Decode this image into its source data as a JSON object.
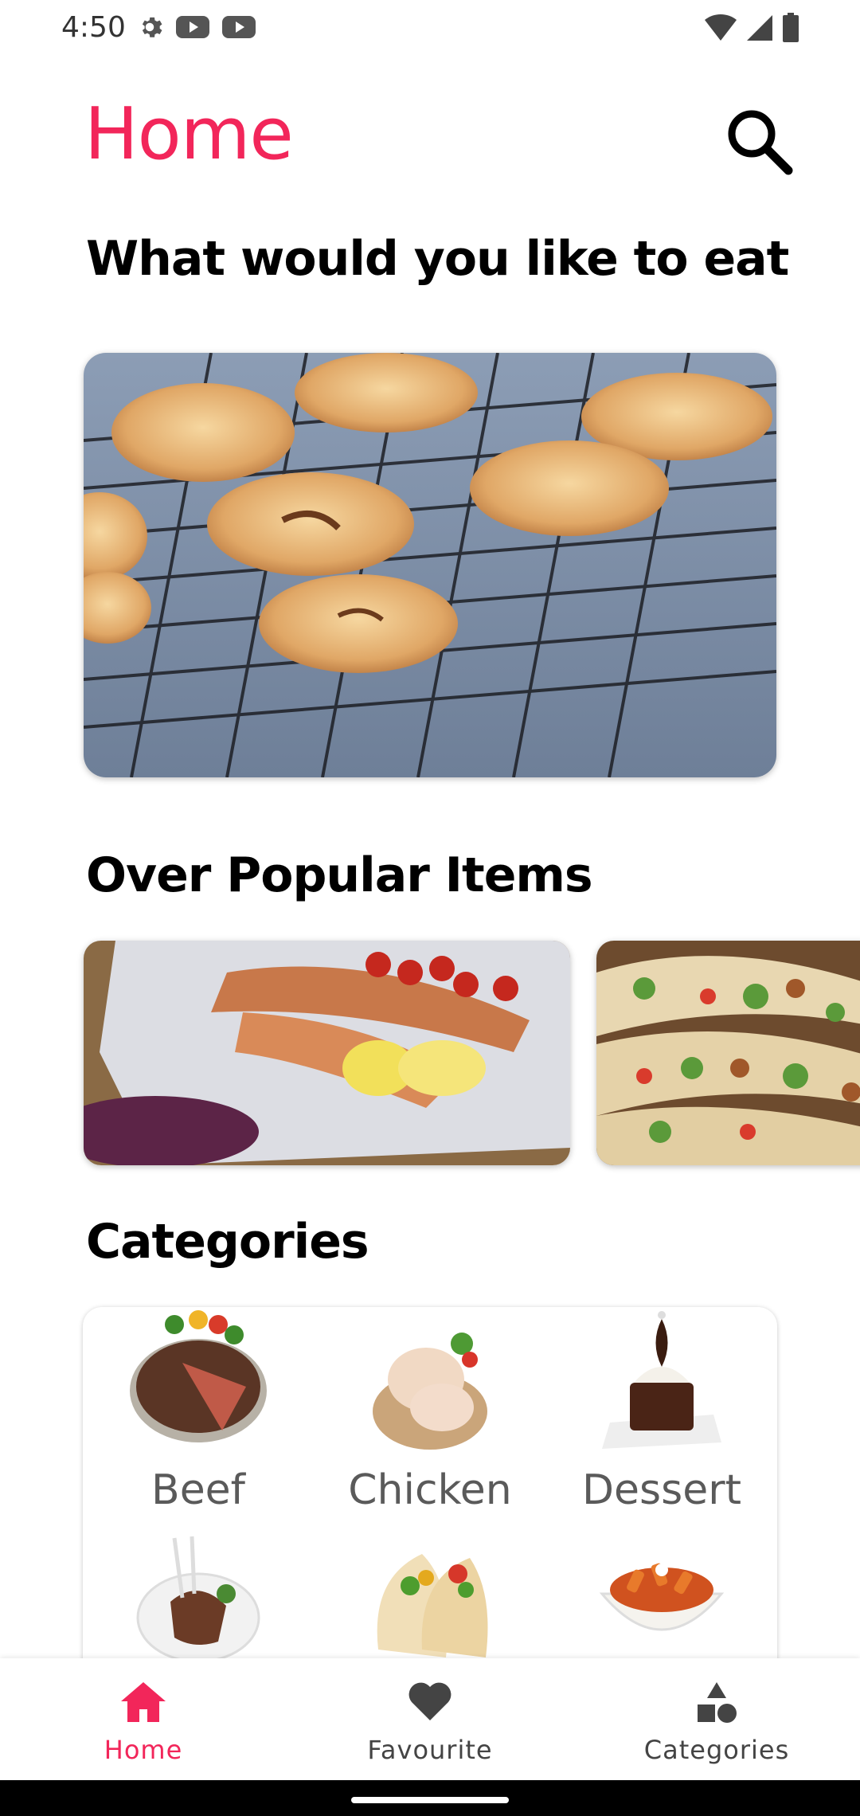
{
  "status_bar": {
    "time": "4:50",
    "left_icons": [
      "gear-icon",
      "youtube-icon",
      "youtube-icon"
    ],
    "right_icons": [
      "wifi-icon",
      "signal-icon",
      "battery-icon"
    ]
  },
  "header": {
    "title": "Home",
    "search_icon": "search-icon"
  },
  "sections": {
    "eat_heading": "What would you like to eat",
    "popular_heading": "Over Popular Items",
    "categories_heading": "Categories"
  },
  "categories": [
    {
      "label": "Beef"
    },
    {
      "label": "Chicken"
    },
    {
      "label": "Dessert"
    },
    {
      "label": ""
    },
    {
      "label": ""
    },
    {
      "label": ""
    }
  ],
  "bottom_nav": {
    "items": [
      {
        "label": "Home",
        "icon": "home-icon",
        "active": true
      },
      {
        "label": "Favourite",
        "icon": "heart-icon",
        "active": false
      },
      {
        "label": "Categories",
        "icon": "categories-icon",
        "active": false
      }
    ]
  },
  "colors": {
    "accent": "#f2265a",
    "text": "#000000",
    "muted": "#5a5a5a"
  }
}
